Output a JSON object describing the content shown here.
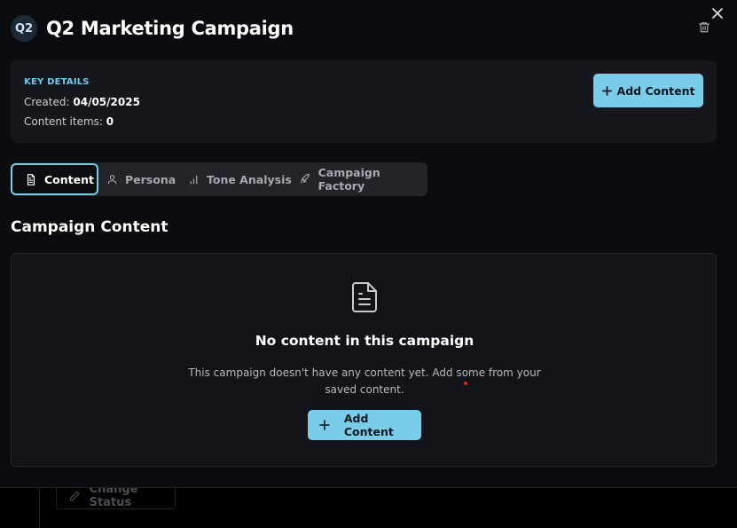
{
  "header": {
    "avatar_text": "Q2",
    "title": "Q2 Marketing Campaign"
  },
  "details": {
    "section_label": "KEY DETAILS",
    "created_label": "Created:",
    "created_value": "04/05/2025",
    "items_label": "Content items:",
    "items_value": "0",
    "add_button_label": "Add Content"
  },
  "tabs": [
    {
      "label": "Content",
      "icon": "file-text-icon",
      "active": true
    },
    {
      "label": "Persona",
      "icon": "user-icon",
      "active": false
    },
    {
      "label": "Tone Analysis",
      "icon": "bar-chart-icon",
      "active": false
    },
    {
      "label": "Campaign Factory",
      "icon": "rocket-icon",
      "active": false
    }
  ],
  "main": {
    "section_title": "Campaign Content",
    "empty_title": "No content in this campaign",
    "empty_description": "This campaign doesn't have any content yet. Add some from your saved content.",
    "add_button_label": "Add Content"
  },
  "background": {
    "change_status_label": "Change Status"
  },
  "colors": {
    "accent": "#79cde9",
    "background": "#0b0c0f",
    "panel": "#16171c"
  }
}
